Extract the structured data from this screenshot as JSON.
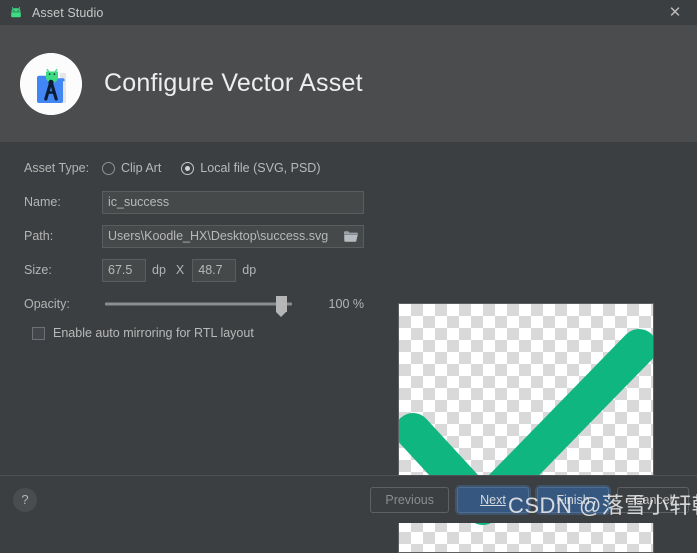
{
  "titlebar": {
    "title": "Asset Studio",
    "icon": "android-robot-icon",
    "close_label": "✕"
  },
  "header": {
    "title": "Configure Vector Asset",
    "icon": "asset-studio-icon"
  },
  "form": {
    "asset_type": {
      "label": "Asset Type:",
      "options": [
        {
          "label": "Clip Art",
          "selected": false
        },
        {
          "label": "Local file (SVG, PSD)",
          "selected": true
        }
      ]
    },
    "name": {
      "label": "Name:",
      "value": "ic_success",
      "placeholder": ""
    },
    "path": {
      "label": "Path:",
      "value": "Users\\Koodle_HX\\Desktop\\success.svg",
      "placeholder": "",
      "browse_icon": "folder-icon"
    },
    "size": {
      "label": "Size:",
      "width_value": "67.5",
      "height_value": "48.7",
      "unit": "dp",
      "separator": "X"
    },
    "opacity": {
      "label": "Opacity:",
      "value": "100 %",
      "percent": 100
    },
    "mirroring": {
      "label": "Enable auto mirroring for RTL layout",
      "checked": false
    }
  },
  "preview": {
    "name": "vector-preview",
    "asset": "green-checkmark",
    "accent_color": "#10b67f"
  },
  "footer": {
    "help_label": "?",
    "buttons": [
      {
        "label": "Previous",
        "state": "disabled",
        "primary": false
      },
      {
        "label": "Next",
        "state": "focused",
        "primary": true,
        "mnemonic": "N"
      },
      {
        "label": "Finish",
        "state": "enabled",
        "primary": true
      },
      {
        "label": "Cancel",
        "state": "enabled",
        "primary": false
      }
    ]
  },
  "watermark": {
    "text": "CSDN @落雪小轩韩"
  },
  "colors": {
    "window_bg": "#3c3f41",
    "header_bg": "#4a4c4e",
    "input_bg": "#45494a",
    "accent_blue": "#365880",
    "check_green": "#10b67f"
  }
}
